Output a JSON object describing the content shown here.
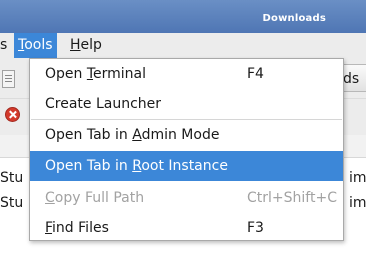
{
  "window": {
    "title": "Downloads"
  },
  "menubar": {
    "items": [
      {
        "label_plain": "s",
        "underline": "",
        "rest": ""
      },
      {
        "label_plain": "",
        "underline": "T",
        "rest": "ools"
      },
      {
        "label_plain": "",
        "underline": "H",
        "rest": "elp"
      }
    ],
    "active": "Tools"
  },
  "toolbar": {
    "right_button_label": "ds"
  },
  "file_rows": [
    {
      "left": "Stu",
      "right": "im"
    },
    {
      "left": "Stu",
      "right": "im"
    }
  ],
  "tools_menu": {
    "items": [
      {
        "pre": "Open ",
        "u": "T",
        "post": "erminal",
        "shortcut": "F4",
        "state": "normal"
      },
      {
        "pre": "Create Launcher",
        "u": "",
        "post": "",
        "shortcut": "",
        "state": "normal"
      },
      {
        "pre": "Open Tab in ",
        "u": "A",
        "post": "dmin Mode",
        "shortcut": "",
        "state": "normal"
      },
      {
        "pre": "Open Tab in ",
        "u": "R",
        "post": "oot Instance",
        "shortcut": "",
        "state": "highlighted"
      },
      {
        "pre": "",
        "u": "C",
        "post": "opy Full Path",
        "shortcut": "Ctrl+Shift+C",
        "state": "disabled"
      },
      {
        "pre": "",
        "u": "F",
        "post": "ind Files",
        "shortcut": "F3",
        "state": "normal"
      }
    ]
  },
  "icons": {
    "toolbar_doc": "document-icon",
    "status_error": "error-icon"
  },
  "colors": {
    "highlight": "#3c87d8",
    "titlebar": "#5a80bc",
    "disabled_text": "#a2a2a2"
  }
}
